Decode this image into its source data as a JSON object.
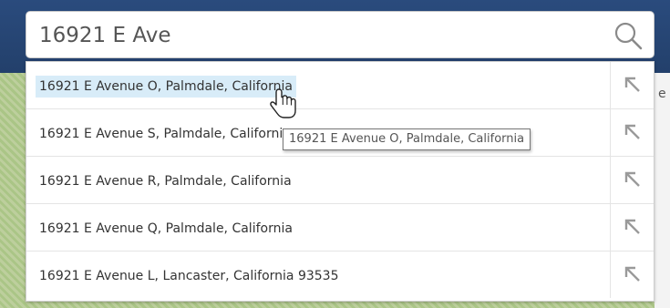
{
  "search": {
    "value": "16921 E Ave",
    "icon": "search-icon"
  },
  "suggestions": [
    {
      "label": "16921 E Avenue O, Palmdale, California",
      "icon": "arrow-up-left-icon"
    },
    {
      "label": "16921 E Avenue S, Palmdale, California",
      "icon": "arrow-up-left-icon"
    },
    {
      "label": "16921 E Avenue R, Palmdale, California",
      "icon": "arrow-up-left-icon"
    },
    {
      "label": "16921 E Avenue Q, Palmdale, California",
      "icon": "arrow-up-left-icon"
    },
    {
      "label": "16921 E Avenue L, Lancaster, California 93535",
      "icon": "arrow-up-left-icon"
    }
  ],
  "tooltip": {
    "text": "16921 E Avenue O, Palmdale, California"
  },
  "background": {
    "peek_text": "e"
  },
  "colors": {
    "header_bg": "#23406b",
    "hover_highlight": "#d8ecf8",
    "map_green": "#b7cc95"
  }
}
